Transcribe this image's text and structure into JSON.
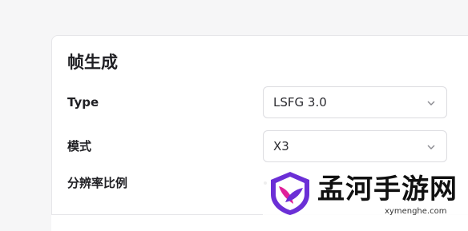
{
  "section": {
    "title": "帧生成",
    "rows": [
      {
        "label": "Type",
        "value": "LSFG 3.0"
      },
      {
        "label": "模式",
        "value": "X3"
      },
      {
        "label": "分辨率比例"
      }
    ]
  },
  "icons": {
    "dropdown": "chevron-down-icon",
    "logo": "shield-logo-icon"
  },
  "watermark": {
    "brand": "孟河手游网",
    "url": "xymenghe.com"
  },
  "colors": {
    "logo_purple": "#6b2fd6",
    "logo_pink": "#e0209a"
  }
}
